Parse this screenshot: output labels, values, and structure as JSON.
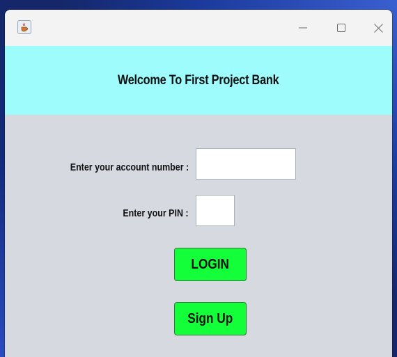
{
  "window": {
    "app_icon": "java-coffee-cup-icon",
    "controls": {
      "minimize": "—",
      "maximize": "☐",
      "close": "X"
    }
  },
  "banner": {
    "title": "Welcome To First Project Bank"
  },
  "form": {
    "account_label": "Enter your account number :",
    "account_value": "",
    "pin_label": "Enter your PIN :",
    "pin_value": ""
  },
  "buttons": {
    "login": "LOGIN",
    "signup": "Sign Up"
  },
  "colors": {
    "banner_bg": "#9ffcfd",
    "body_bg": "#d6d9df",
    "button_bg": "#12ff3a"
  }
}
